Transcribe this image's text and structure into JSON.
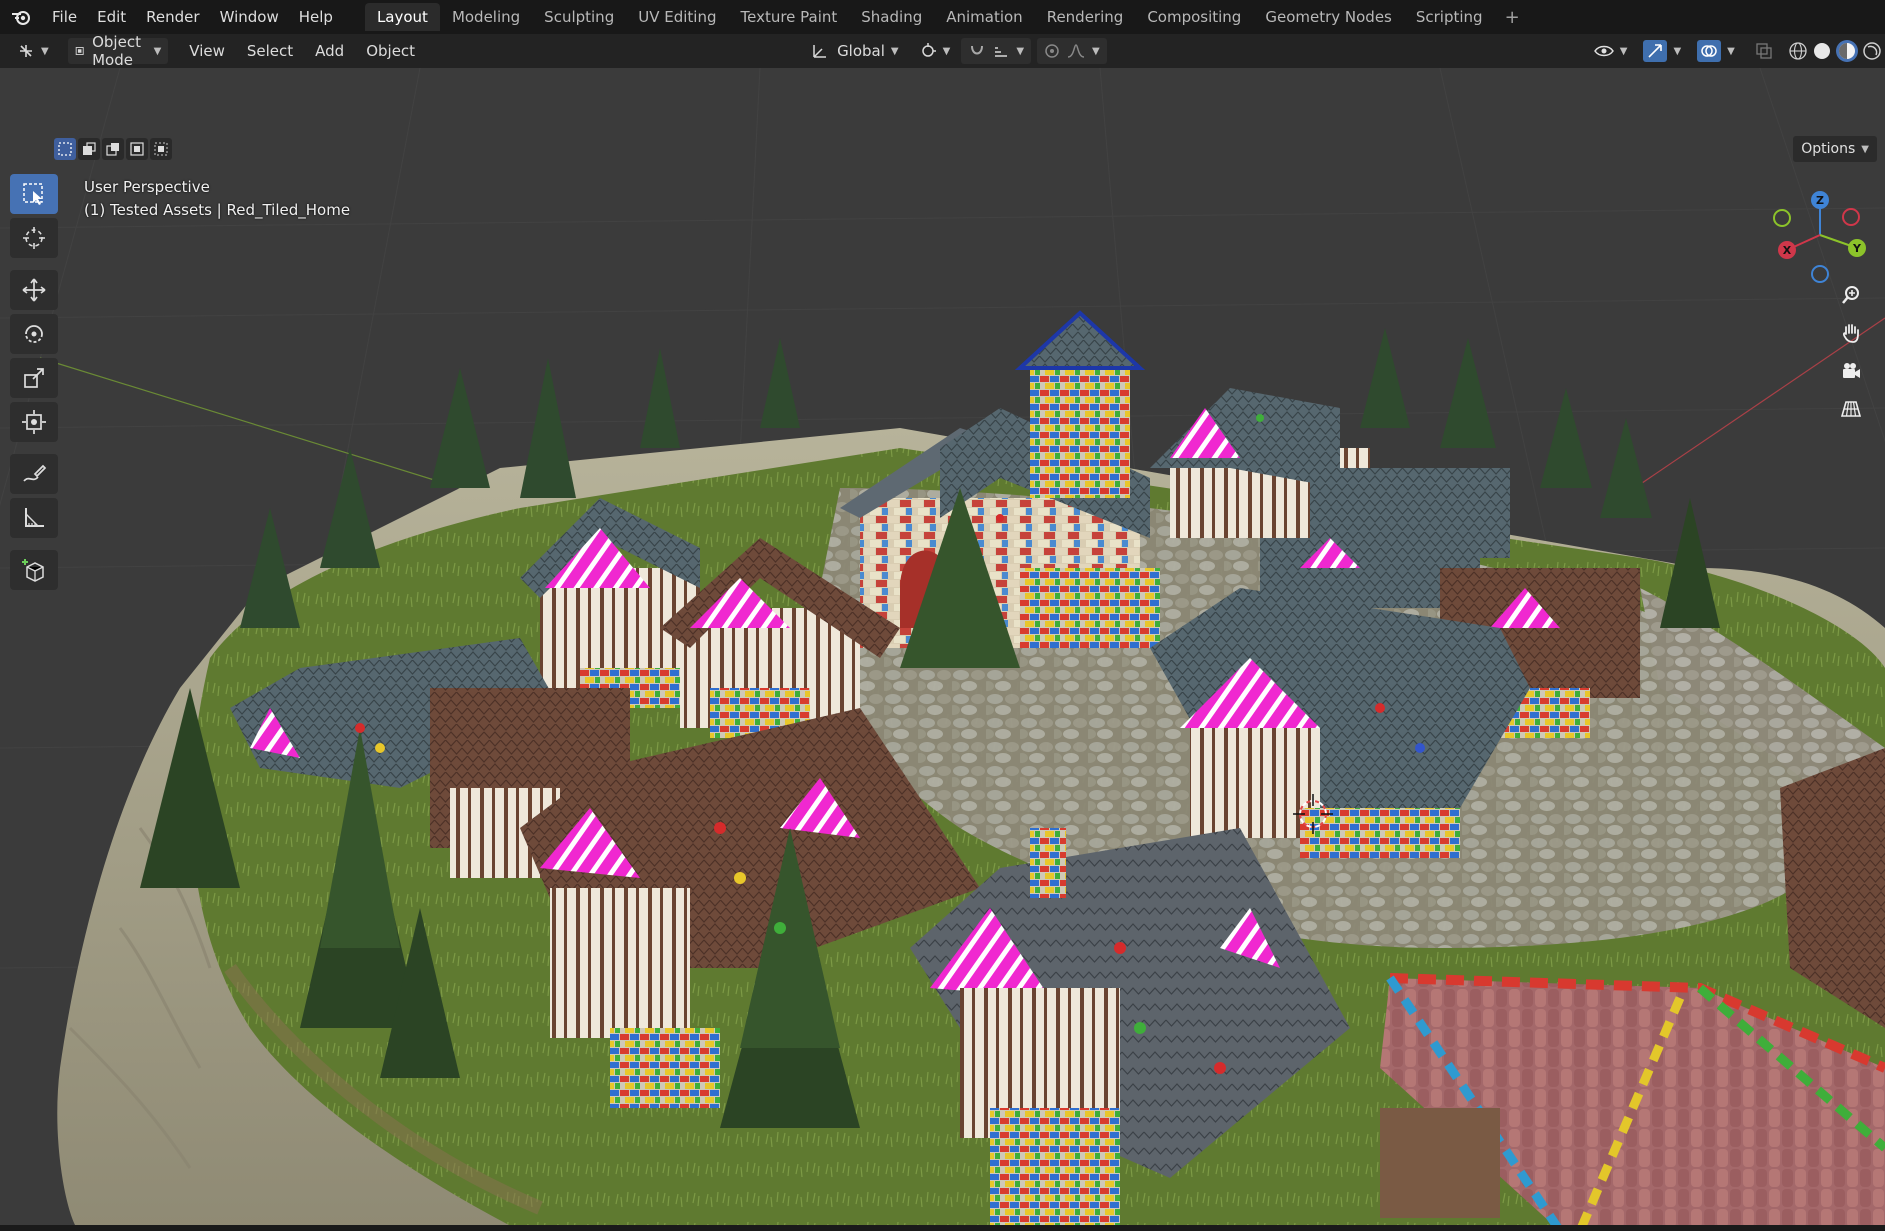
{
  "menubar": {
    "items": [
      "File",
      "Edit",
      "Render",
      "Window",
      "Help"
    ]
  },
  "workspaces": {
    "tabs": [
      "Layout",
      "Modeling",
      "Sculpting",
      "UV Editing",
      "Texture Paint",
      "Shading",
      "Animation",
      "Rendering",
      "Compositing",
      "Geometry Nodes",
      "Scripting"
    ],
    "active": "Layout",
    "add_symbol": "+"
  },
  "header": {
    "mode": "Object Mode",
    "menus": [
      "View",
      "Select",
      "Add",
      "Object"
    ],
    "transform_orientation": "Global"
  },
  "viewport": {
    "options_label": "Options",
    "perspective_label": "User Perspective",
    "collection_label": "(1) Tested Assets | Red_Tiled_Home"
  },
  "gizmo": {
    "axes": [
      "X",
      "Y",
      "Z"
    ],
    "x_color": "#d0374a",
    "y_color": "#8cc32a",
    "z_color": "#3f84d6"
  },
  "colors": {
    "accent": "#4672b4",
    "background": "#1d1d1d",
    "grid": "#3c3c3c"
  },
  "icons": [
    "blender-logo-icon",
    "editor-type-icon",
    "object-mode-icon",
    "transform-orientation-icon",
    "pivot-icon",
    "snap-icon",
    "proportional-icon",
    "visibility-icon",
    "gizmo-icon",
    "overlay-icon",
    "xray-icon",
    "wireframe-shading-icon",
    "solid-shading-icon",
    "material-shading-icon",
    "rendered-shading-icon",
    "select-box-icon",
    "cursor-icon",
    "move-icon",
    "rotate-icon",
    "scale-icon",
    "transform-icon",
    "annotate-icon",
    "measure-icon",
    "add-cube-icon",
    "zoom-icon",
    "hand-icon",
    "camera-icon",
    "grid-toggle-icon"
  ]
}
